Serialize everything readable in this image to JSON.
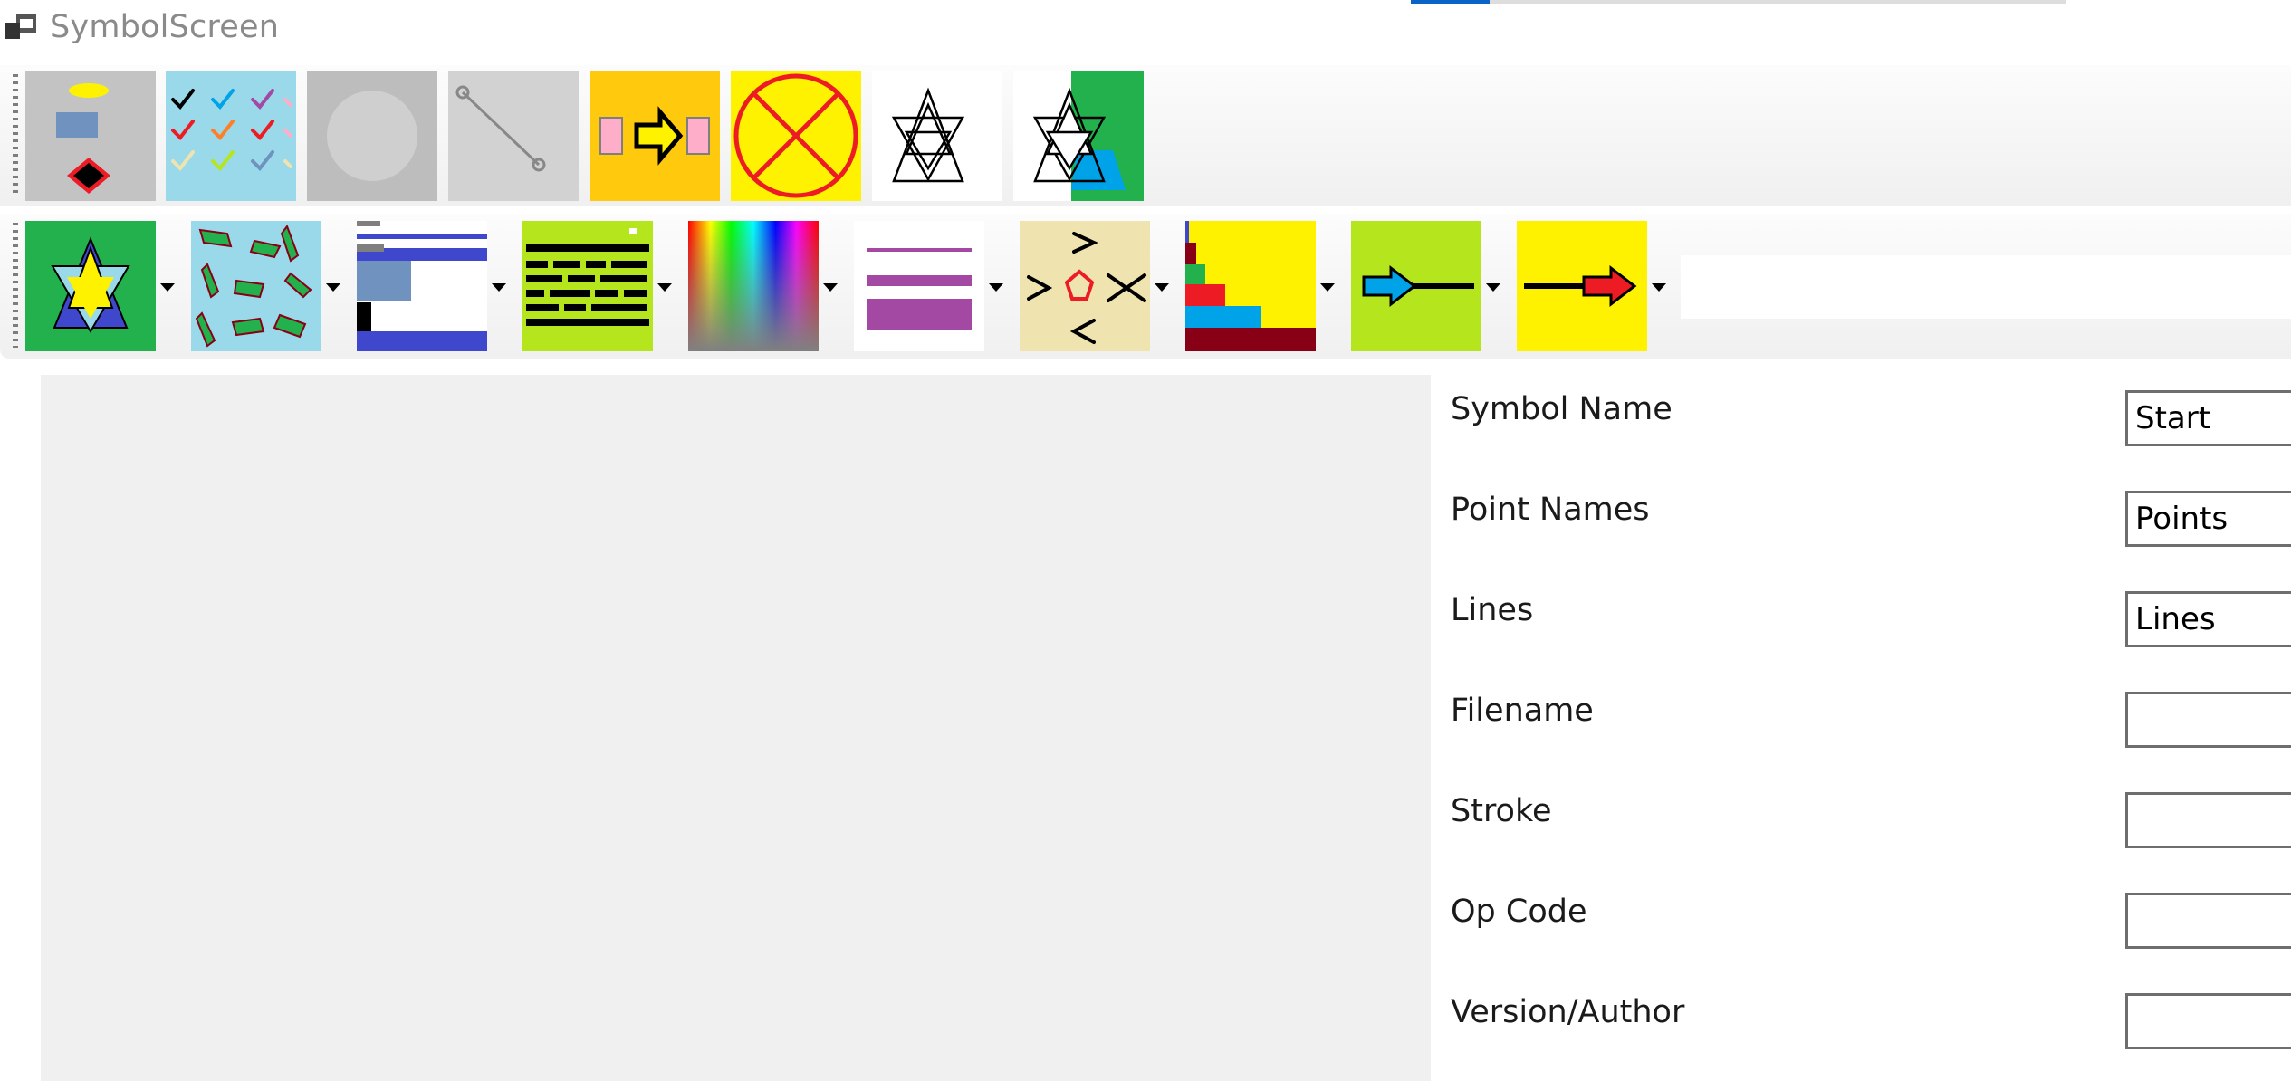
{
  "window": {
    "title": "SymbolScreen",
    "icon": "app-window-icon"
  },
  "progress": {
    "percent": 12
  },
  "toolbar1": {
    "buttons": [
      {
        "name": "flowchart-symbols-button",
        "icon": "flowchart-icon"
      },
      {
        "name": "checkmarks-button",
        "icon": "checkmarks-icon"
      },
      {
        "name": "circle-button",
        "icon": "circle-icon"
      },
      {
        "name": "line-button",
        "icon": "line-icon"
      },
      {
        "name": "connector-arrow-button",
        "icon": "arrow-connector-icon"
      },
      {
        "name": "clear-button",
        "icon": "circle-x-icon"
      },
      {
        "name": "star-outline-button",
        "icon": "star-outline-icon"
      },
      {
        "name": "star-fill-button",
        "icon": "star-fill-icon"
      }
    ]
  },
  "toolbar2": {
    "buttons": [
      {
        "name": "star-style-dropdown",
        "icon": "star-color-icon"
      },
      {
        "name": "arrows-scatter-dropdown",
        "icon": "arrows-scatter-icon"
      },
      {
        "name": "layout-dropdown",
        "icon": "window-layout-icon"
      },
      {
        "name": "text-lines-dropdown",
        "icon": "text-lines-icon"
      },
      {
        "name": "color-picker-dropdown",
        "icon": "color-spectrum-icon"
      },
      {
        "name": "line-style-dropdown",
        "icon": "line-style-icon"
      },
      {
        "name": "markers-dropdown",
        "icon": "markers-icon"
      },
      {
        "name": "histogram-dropdown",
        "icon": "histogram-icon"
      },
      {
        "name": "arrow-start-dropdown",
        "icon": "arrow-start-icon"
      },
      {
        "name": "arrow-end-dropdown",
        "icon": "arrow-end-icon"
      }
    ],
    "search_value": ""
  },
  "properties": [
    {
      "label": "Symbol Name",
      "value": "Start"
    },
    {
      "label": "Point Names",
      "value": "Points"
    },
    {
      "label": "Lines",
      "value": "Lines"
    },
    {
      "label": "Filename",
      "value": ""
    },
    {
      "label": "Stroke",
      "value": ""
    },
    {
      "label": "Op Code",
      "value": ""
    },
    {
      "label": "Version/Author",
      "value": ""
    }
  ],
  "colors": {
    "green": "#22b14c",
    "light_blue": "#99d9ea",
    "blue": "#3f48cc",
    "lime": "#b5e61d",
    "yellow": "#fff200",
    "orange": "#ffc90e",
    "red": "#ed1c24",
    "purple": "#a349a4",
    "tan": "#efe4b0",
    "maroon": "#880015"
  }
}
